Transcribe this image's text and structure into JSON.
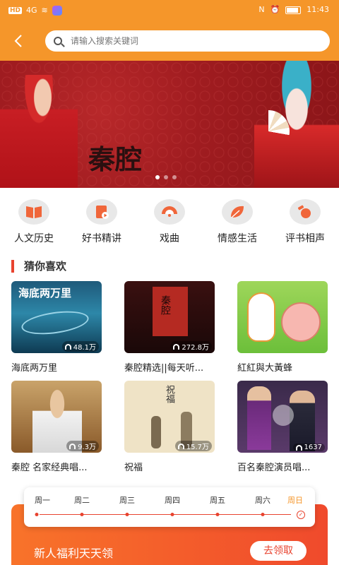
{
  "status_bar": {
    "left_glyphs": [
      "HD",
      "4G",
      "≋"
    ],
    "time": "11:43",
    "right_glyphs": [
      "N",
      "⏰",
      "▮"
    ]
  },
  "nav": {
    "back_icon": "chevron-left-icon",
    "search_placeholder": "请输入搜索关键词"
  },
  "banner": {
    "title": "秦腔",
    "dots": 3,
    "active_dot": 0
  },
  "categories": [
    {
      "label": "人文历史",
      "icon": "book-icon"
    },
    {
      "label": "好书精讲",
      "icon": "book-play-icon"
    },
    {
      "label": "戏曲",
      "icon": "fan-icon"
    },
    {
      "label": "情感生活",
      "icon": "leaf-icon"
    },
    {
      "label": "评书相声",
      "icon": "gavel-icon"
    }
  ],
  "section": {
    "title": "猜你喜欢"
  },
  "items": [
    {
      "title": "海底两万里",
      "count": "48.1万",
      "thumb_text": "海底两万里"
    },
    {
      "title": "秦腔精选||每天听...",
      "count": "272.8万",
      "thumb_text": "秦腔"
    },
    {
      "title": "紅紅與大黃蜂",
      "count": "",
      "thumb_text": ""
    },
    {
      "title": "秦腔 名家经典唱...",
      "count": "9.3万",
      "thumb_text": ""
    },
    {
      "title": "祝福",
      "count": "15.7万",
      "thumb_text": "祝福"
    },
    {
      "title": "百名秦腔演员唱...",
      "count": "1637",
      "thumb_text": ""
    }
  ],
  "week": {
    "days": [
      "周一",
      "周二",
      "周三",
      "周四",
      "周五",
      "周六",
      "周日"
    ],
    "today_index": 6
  },
  "promo": {
    "text": "新人福利天天领",
    "button": "去领取"
  },
  "colors": {
    "accent_orange": "#f5962a",
    "accent_red": "#e8432f"
  }
}
